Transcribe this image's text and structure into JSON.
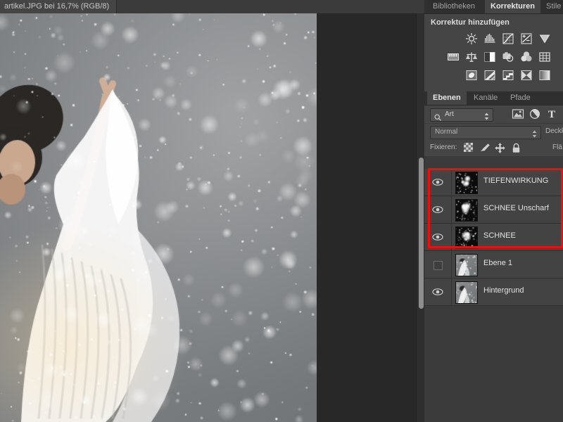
{
  "document": {
    "tab_title": "artikel.JPG bei 16,7% (RGB/8)"
  },
  "dock": {
    "top_tabs": [
      {
        "label": "Bibliotheken",
        "active": false
      },
      {
        "label": "Korrekturen",
        "active": true
      },
      {
        "label": "Stile",
        "active": false
      }
    ],
    "adjustments": {
      "title": "Korrektur hinzufügen",
      "rows": [
        [
          "brightness-contrast-icon",
          "levels-icon",
          "curves-icon",
          "exposure-icon",
          "vibrance-icon"
        ],
        [
          "hue-saturation-icon",
          "color-balance-icon",
          "black-white-icon",
          "photo-filter-icon",
          "channel-mixer-icon",
          "color-lookup-icon"
        ],
        [
          "invert-icon",
          "posterize-icon",
          "threshold-icon",
          "gradient-map-icon",
          "selective-color-icon"
        ]
      ]
    }
  },
  "layers_panel": {
    "tabs": [
      {
        "label": "Ebenen",
        "active": true
      },
      {
        "label": "Kanäle",
        "active": false
      },
      {
        "label": "Pfade",
        "active": false
      }
    ],
    "filter": {
      "kind_label": "Art",
      "icons": [
        "pixel-layer-filter-icon",
        "adjustment-layer-filter-icon",
        "type-layer-filter-icon"
      ]
    },
    "blend_mode": "Normal",
    "opacity_label": "Deckk",
    "lock": {
      "label": "Fixieren:",
      "icons": [
        "lock-transparent-pixels-icon",
        "lock-image-pixels-icon",
        "lock-position-icon",
        "lock-all-icon"
      ],
      "fill_label": "Flä"
    },
    "layers": [
      {
        "name": "TIEFENWIRKUNG",
        "visible": true,
        "thumb": "snow-blob",
        "highlighted": true
      },
      {
        "name": "SCHNEE Unscharf",
        "visible": true,
        "thumb": "snow-blob",
        "highlighted": true
      },
      {
        "name": "SCHNEE",
        "visible": true,
        "thumb": "snow-blob",
        "highlighted": true
      },
      {
        "name": "Ebene 1",
        "visible": false,
        "thumb": "photo",
        "highlighted": false
      },
      {
        "name": "Hintergrund",
        "visible": true,
        "thumb": "photo",
        "highlighted": false
      }
    ]
  },
  "colors": {
    "highlight_box": "#f40c0c",
    "panel_bg": "#3b3b3b",
    "panel_light": "#454545",
    "canvas_bg": "#282828",
    "text": "#e2e2e2"
  }
}
